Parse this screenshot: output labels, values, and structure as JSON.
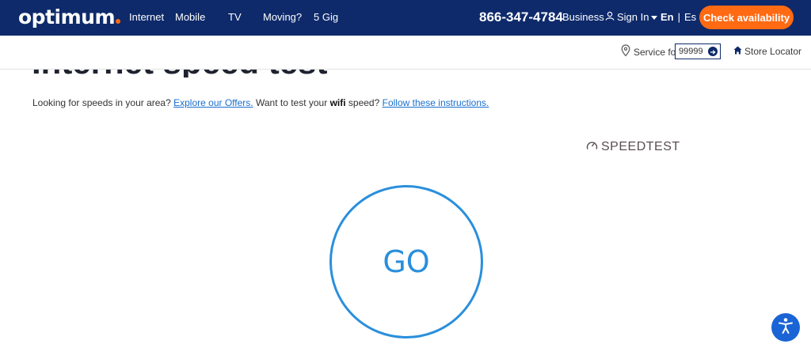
{
  "header": {
    "logo": "optimum",
    "nav": [
      "Internet",
      "Mobile",
      "TV",
      "Moving?",
      "5 Gig"
    ],
    "phone": "866-347-4784",
    "business": "Business",
    "sign_in": "Sign In",
    "lang_en": "En",
    "lang_sep": "|",
    "lang_es": "Es",
    "cta": "Check availability",
    "colors": {
      "navy": "#0e2a6b",
      "orange": "#ff6a13"
    }
  },
  "subbar": {
    "service_for": "Service for",
    "zip_value": "99999",
    "store_locator": "Store Locator",
    "icons": {
      "service": "location-pin-icon",
      "store": "home-icon",
      "zip_go": "arrow-right-circle-icon"
    }
  },
  "content": {
    "heading": "Internet speed test",
    "intro": {
      "t1": "Looking for speeds in your area? ",
      "link1": "Explore our Offers.",
      "t2": " Want to test your ",
      "bold": "wifi",
      "t3": " speed? ",
      "link2": "Follow these instructions."
    },
    "speedtest_logo": "SPEEDTEST",
    "go_button": "GO",
    "accent": "#2a8fdc"
  }
}
